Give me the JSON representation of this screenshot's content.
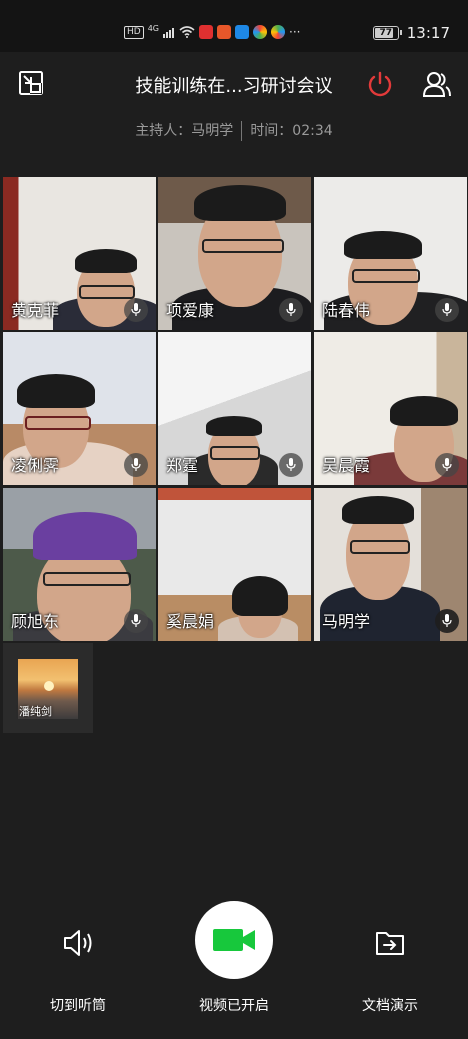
{
  "status_bar": {
    "network": "HD",
    "signal_label": "4G",
    "battery": "77",
    "time": "13:17",
    "more": "···"
  },
  "header": {
    "title": "技能训练在...习研讨会议",
    "host_label": "主持人：马明学",
    "time_label": "时间：02:34"
  },
  "participants": [
    {
      "name": "黄克菲"
    },
    {
      "name": "项爱康"
    },
    {
      "name": "陆春伟"
    },
    {
      "name": "凌俐霁"
    },
    {
      "name": "郑霆"
    },
    {
      "name": "吴晨霞"
    },
    {
      "name": "顾旭东"
    },
    {
      "name": "奚晨娟"
    },
    {
      "name": "马明学"
    }
  ],
  "extra_participant": {
    "name": "潘纯剑"
  },
  "controls": {
    "speaker_label": "切到听筒",
    "video_label": "视频已开启",
    "doc_label": "文档演示"
  },
  "colors": {
    "accent_green": "#17c83c",
    "power_red": "#e23a3a",
    "background": "#1e1e1e"
  }
}
